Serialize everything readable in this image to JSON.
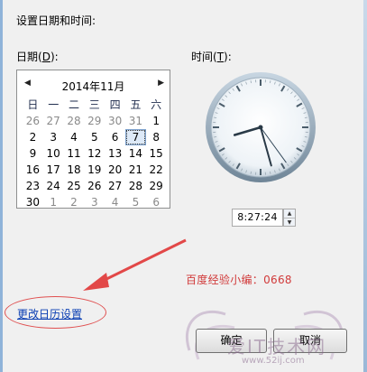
{
  "dialog": {
    "title": "设置日期和时间:",
    "date_label_prefix": "日期(",
    "date_label_key": "D",
    "date_label_suffix": "):",
    "time_label_prefix": "时间(",
    "time_label_key": "T",
    "time_label_suffix": "):"
  },
  "calendar": {
    "month_title": "2014年11月",
    "weekdays": [
      "日",
      "一",
      "二",
      "三",
      "四",
      "五",
      "六"
    ],
    "weeks": [
      [
        "26",
        "27",
        "28",
        "29",
        "30",
        "31",
        "1"
      ],
      [
        "2",
        "3",
        "4",
        "5",
        "6",
        "7",
        "8"
      ],
      [
        "9",
        "10",
        "11",
        "12",
        "13",
        "14",
        "15"
      ],
      [
        "16",
        "17",
        "18",
        "19",
        "20",
        "21",
        "22"
      ],
      [
        "23",
        "24",
        "25",
        "26",
        "27",
        "28",
        "29"
      ],
      [
        "30",
        "1",
        "2",
        "3",
        "4",
        "5",
        "6"
      ]
    ],
    "selected_day": "7"
  },
  "clock": {
    "time_value": "8:27:24",
    "hours": 8,
    "minutes": 27,
    "seconds": 24
  },
  "annotation": {
    "watermark_text": "百度经验小编：0668",
    "color": "#d13a3a"
  },
  "links": {
    "change_calendar": "更改日历设置"
  },
  "buttons": {
    "ok": "确定",
    "cancel": "取消"
  },
  "site_watermark": {
    "text": "爱IT技术网",
    "url": "www.52ij.com"
  }
}
